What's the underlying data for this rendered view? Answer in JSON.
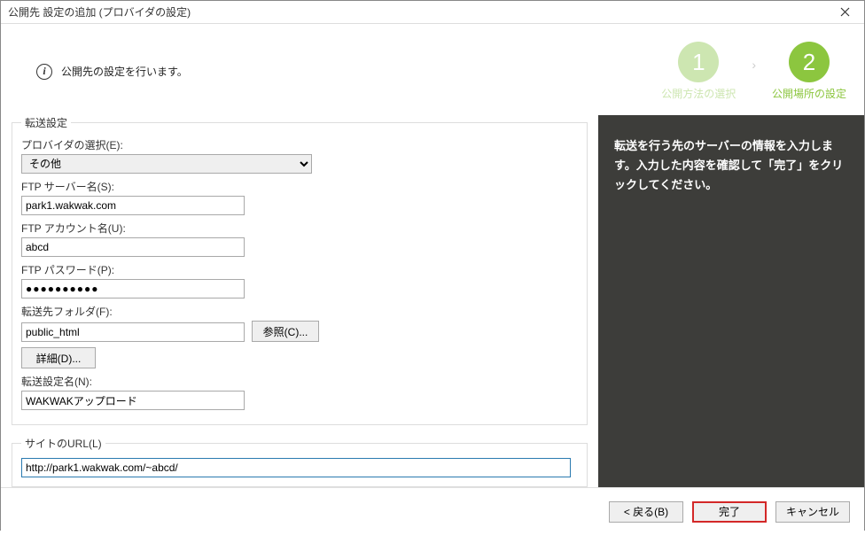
{
  "window": {
    "title": "公開先 設定の追加 (プロバイダの設定)"
  },
  "header": {
    "info": "公開先の設定を行います。",
    "step1_num": "1",
    "step1_label": "公開方法の選択",
    "step2_num": "2",
    "step2_label": "公開場所の設定",
    "arrow": "›"
  },
  "transfer": {
    "legend": "転送設定",
    "provider_label": "プロバイダの選択(E):",
    "provider_value": "その他",
    "ftp_server_label": "FTP サーバー名(S):",
    "ftp_server_value": "park1.wakwak.com",
    "ftp_account_label": "FTP アカウント名(U):",
    "ftp_account_value": "abcd",
    "ftp_password_label": "FTP パスワード(P):",
    "ftp_password_value": "●●●●●●●●●●",
    "dest_folder_label": "転送先フォルダ(F):",
    "dest_folder_value": "public_html",
    "browse_button": "参照(C)...",
    "detail_button": "詳細(D)...",
    "setting_name_label": "転送設定名(N):",
    "setting_name_value": "WAKWAKアップロード"
  },
  "siteurl": {
    "legend": "サイトのURL(L)",
    "value": "http://park1.wakwak.com/~abcd/"
  },
  "sidebar": {
    "text": "転送を行う先のサーバーの情報を入力します。入力した内容を確認して「完了」をクリックしてください。"
  },
  "footer": {
    "back": "< 戻る(B)",
    "finish": "完了",
    "cancel": "キャンセル"
  }
}
